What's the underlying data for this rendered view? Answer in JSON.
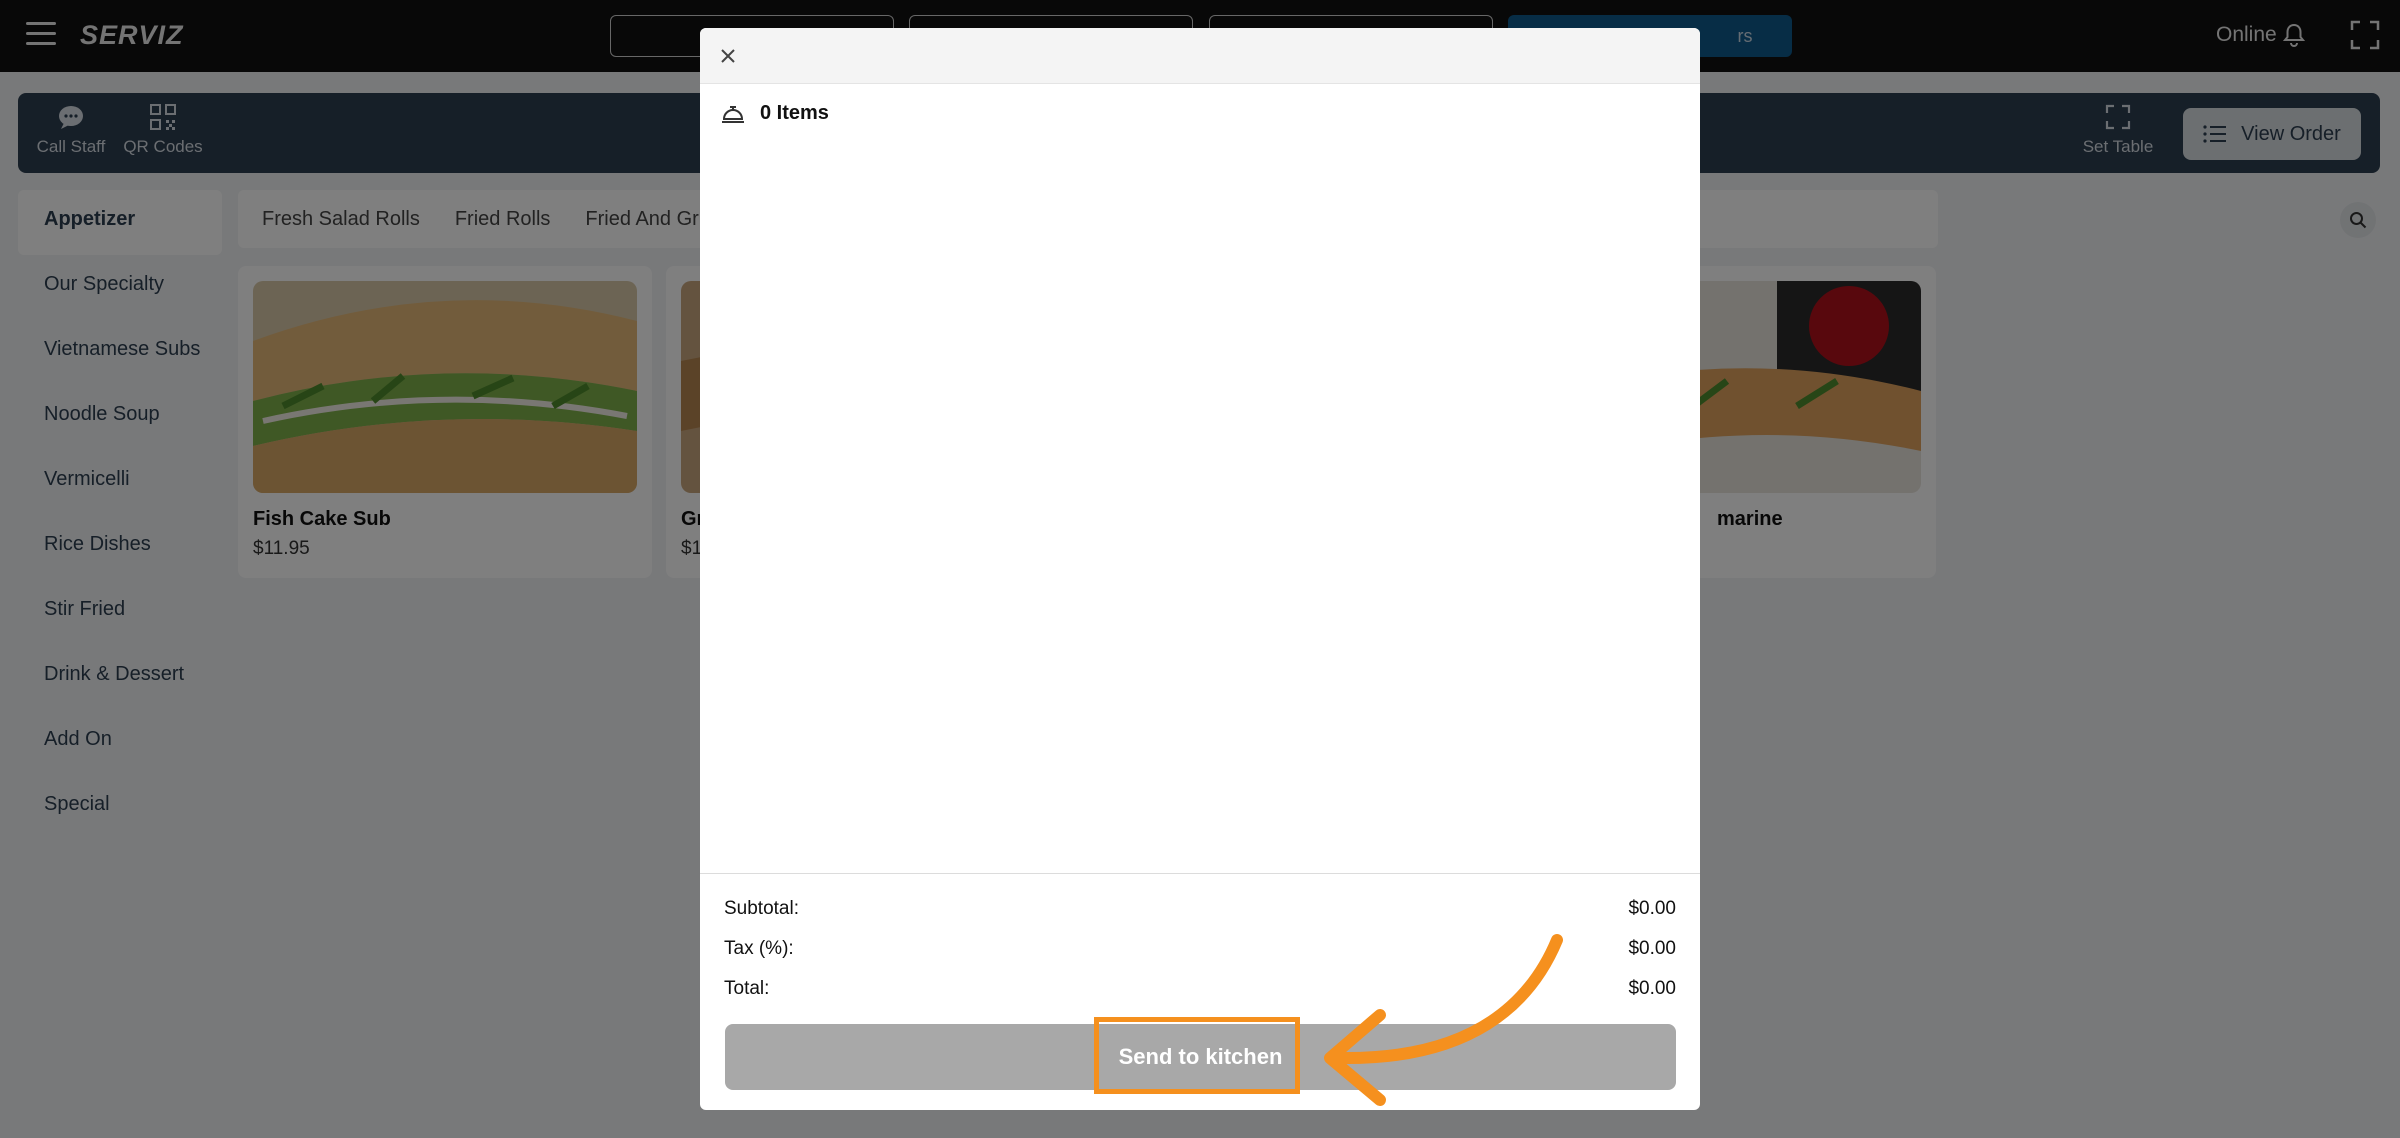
{
  "topbar": {
    "logo": "SERVIZ",
    "tabs": [
      {
        "label": ""
      },
      {
        "label": ""
      },
      {
        "label": ""
      },
      {
        "label": "rs"
      }
    ],
    "status": "Online"
  },
  "toolbar": {
    "call_staff": "Call Staff",
    "qr_codes": "QR Codes",
    "set_table": "Set Table",
    "view_order": "View Order"
  },
  "sidebar": {
    "items": [
      {
        "label": "Appetizer"
      },
      {
        "label": "Our Specialty"
      },
      {
        "label": "Vietnamese Subs"
      },
      {
        "label": "Noodle Soup"
      },
      {
        "label": "Vermicelli"
      },
      {
        "label": "Rice Dishes"
      },
      {
        "label": "Stir Fried"
      },
      {
        "label": "Drink & Dessert"
      },
      {
        "label": "Add On"
      },
      {
        "label": "Special"
      }
    ]
  },
  "subcategories": [
    {
      "label": "Fresh Salad Rolls"
    },
    {
      "label": "Fried Rolls"
    },
    {
      "label": "Fried And Grilled"
    }
  ],
  "products": [
    {
      "name": "Fish Cake Sub",
      "price": "$11.95"
    },
    {
      "name": "Gr",
      "price": "$1"
    },
    {
      "name": "marine",
      "price": ""
    }
  ],
  "cart": {
    "items_count": "0 Items",
    "subtotal_label": "Subtotal:",
    "subtotal_value": "$0.00",
    "tax_label": "Tax (%):",
    "tax_value": "$0.00",
    "total_label": "Total:",
    "total_value": "$0.00",
    "send_button": "Send to kitchen"
  },
  "colors": {
    "accent_annotation": "#f5901e",
    "topbar": "#111111",
    "toolbar": "#2d3e50",
    "active_tab": "#0f5a8c"
  }
}
